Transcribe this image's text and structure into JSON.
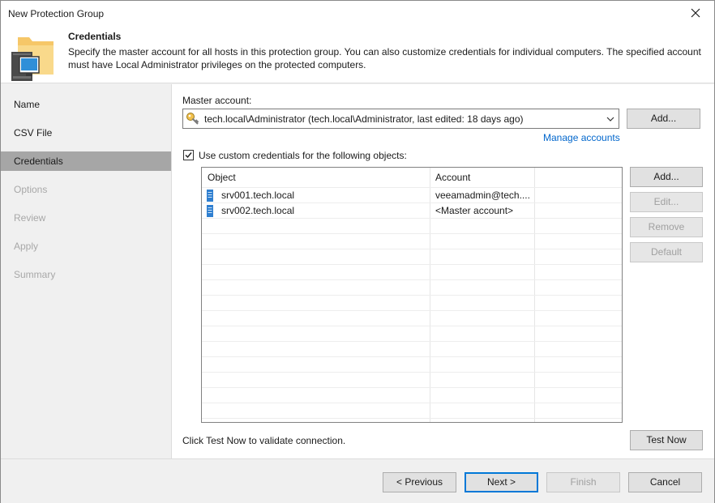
{
  "window": {
    "title": "New Protection Group",
    "close_icon": "close-icon"
  },
  "header": {
    "title": "Credentials",
    "description": "Specify the master account for all hosts in this protection group. You can also customize credentials for individual computers. The specified account must have Local Administrator privileges on the protected computers."
  },
  "nav": {
    "items": [
      {
        "label": "Name",
        "state": "normal"
      },
      {
        "label": "CSV File",
        "state": "normal"
      },
      {
        "label": "Credentials",
        "state": "active"
      },
      {
        "label": "Options",
        "state": "disabled"
      },
      {
        "label": "Review",
        "state": "disabled"
      },
      {
        "label": "Apply",
        "state": "disabled"
      },
      {
        "label": "Summary",
        "state": "disabled"
      }
    ]
  },
  "main": {
    "master_account_label": "Master account:",
    "master_account_value": "tech.local\\Administrator (tech.local\\Administrator, last edited: 18 days ago)",
    "add_master_label": "Add...",
    "manage_accounts_label": "Manage accounts",
    "custom_credentials_label": "Use custom credentials for the following objects:",
    "custom_credentials_checked": true,
    "table": {
      "columns": [
        "Object",
        "Account"
      ],
      "rows": [
        {
          "object": "srv001.tech.local",
          "account": "veeamadmin@tech...."
        },
        {
          "object": "srv002.tech.local",
          "account": "<Master account>"
        }
      ]
    },
    "side_buttons": {
      "add": "Add...",
      "edit": "Edit...",
      "remove": "Remove",
      "default": "Default"
    },
    "test_hint": "Click Test Now to validate connection.",
    "test_now_label": "Test Now"
  },
  "footer": {
    "previous": "< Previous",
    "next": "Next >",
    "finish": "Finish",
    "cancel": "Cancel"
  },
  "colors": {
    "accent": "#0078d7",
    "link": "#0066cc",
    "nav_active": "#a6a6a6"
  }
}
